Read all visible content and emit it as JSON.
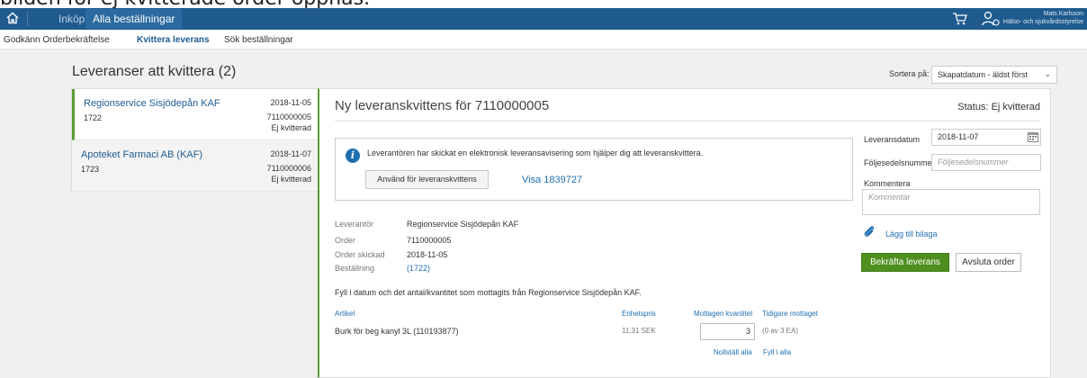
{
  "caption": "bilden för ej kvitterade order öppnas.",
  "topbar": {
    "nav_inkop": "Inköp",
    "nav_alla": "Alla beställningar",
    "user_name": "Mats Karlsson",
    "user_org": "Hälso- och sjukvårdsstyrelse"
  },
  "subnav": {
    "item1": "Godkänn Orderbekräftelse",
    "item2": "Kvittera leverans",
    "item3": "Sök beställningar"
  },
  "main": {
    "heading": "Leveranser att kvittera (2)",
    "sort_label": "Sortera på:",
    "sort_value": "Skapatdatum - äldst först"
  },
  "list": [
    {
      "name": "Regionservice Sisjödepån KAF",
      "num": "1722",
      "date": "2018-11-05",
      "order": "7110000005",
      "status": "Ej kvitterad"
    },
    {
      "name": "Apoteket Farmaci AB (KAF)",
      "num": "1723",
      "date": "2018-11-07",
      "order": "7110000006",
      "status": "Ej kvitterad"
    }
  ],
  "panel": {
    "title": "Ny leveranskvittens för 7110000005",
    "status": "Status: Ej kvitterad",
    "info_text": "Leverantören har skickat en elektronisk leveransavisering som hjälper dig att leveranskvittera.",
    "use_button": "Använd för leveranskvittens",
    "visa_link": "Visa 1839727",
    "details": {
      "supplier_label": "Leverantör",
      "supplier_value": "Regionservice Sisjödepån KAF",
      "order_label": "Order",
      "order_value": "7110000005",
      "sent_label": "Order skickad",
      "sent_value": "2018-11-05",
      "bestallning_label": "Beställning",
      "bestallning_value": "(1722)"
    },
    "fill_text": "Fyll i datum och det antal/kvantitet som mottagits från Regionservice Sisjödepån KAF.",
    "table": {
      "col_artikel": "Artikel",
      "col_enhetspris": "Enhetspris",
      "col_mottagen": "Mottagen kvantitet",
      "col_tidigare": "Tidigare mottaget",
      "row_artikel": "Burk för beg kanyl 3L (110193877)",
      "row_price": "11,31 SEK",
      "row_qty": "3",
      "row_prev": "(0 av 3 EA)",
      "reset_all": "Nollställ alla",
      "fill_all": "Fyll i alla"
    }
  },
  "right": {
    "date_label": "Leveransdatum",
    "date_value": "2018-11-07",
    "folj_label": "Följesedelsnummer",
    "folj_placeholder": "Följesedelsnummer",
    "komm_label": "Kommentera",
    "komm_placeholder": "Kommentar",
    "bilaga_link": "Lägg till bilaga",
    "confirm_button": "Bekräfta leverans",
    "close_button": "Avsluta order"
  },
  "colors": {
    "topbar": "#1f5b8f",
    "accent_green": "#4e8f1f",
    "link_blue": "#1f6fb0"
  },
  "icons": [
    "home-icon",
    "cart-icon",
    "user-icon",
    "info-icon",
    "calendar-icon",
    "paperclip-icon",
    "chevron-down-icon"
  ]
}
